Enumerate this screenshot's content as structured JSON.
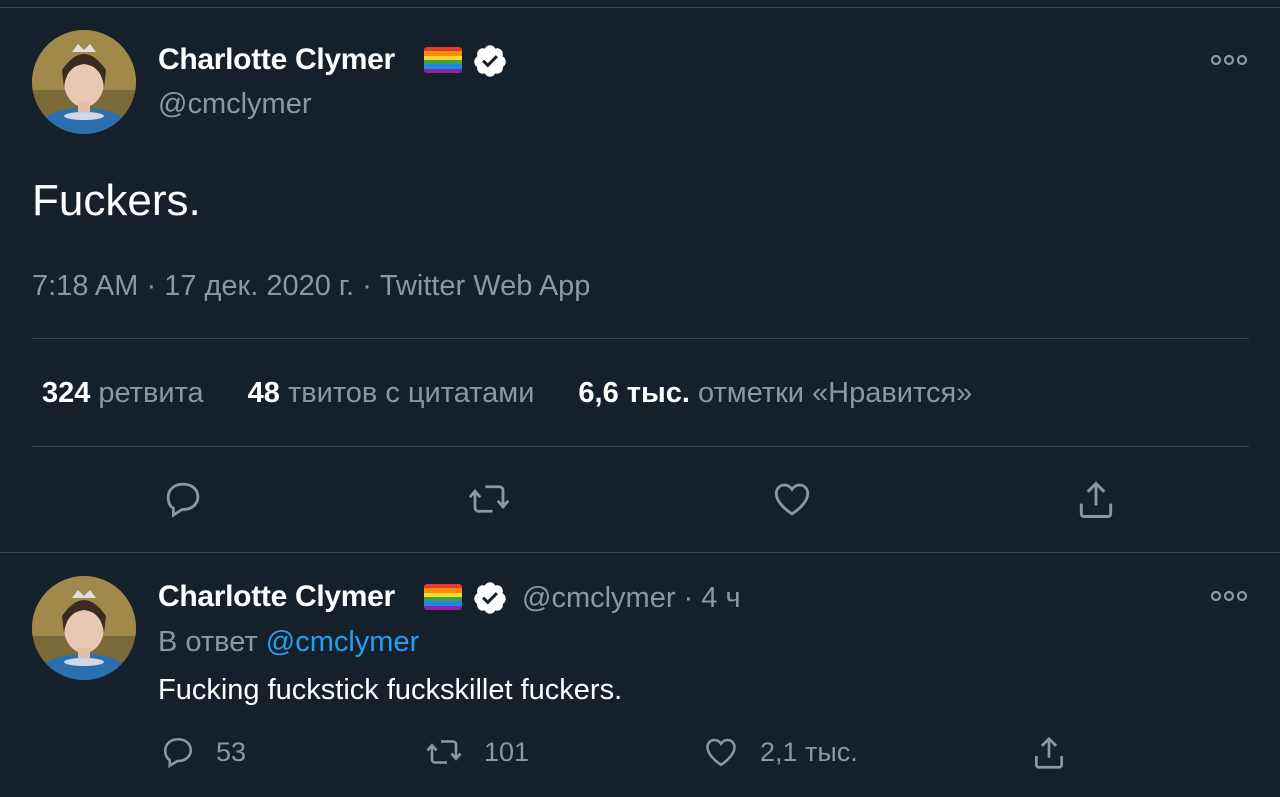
{
  "tweet": {
    "author_name": "Charlotte Clymer",
    "author_handle": "@cmclymer",
    "flag_emoji": "rainbow-flag",
    "verified_icon": "verified-badge-icon",
    "text": "Fuckers.",
    "time": "7:18 AM",
    "date": "17 дек. 2020 г.",
    "source": "Twitter Web App",
    "stats": {
      "retweets_count": "324",
      "retweets_label": "ретвита",
      "quotes_count": "48",
      "quotes_label": "твитов с цитатами",
      "likes_count": "6,6 тыс.",
      "likes_label": "отметки «Нравится»"
    }
  },
  "reply": {
    "author_name": "Charlotte Clymer",
    "author_handle": "@cmclymer",
    "time_ago": "4 ч",
    "reply_prefix": "В ответ",
    "reply_to_handle": "@cmclymer",
    "text": "Fucking fuckstick fuckskillet fuckers.",
    "replies_count": "53",
    "retweets_count": "101",
    "likes_count": "2,1 тыс."
  },
  "colors": {
    "background": "#15202b",
    "divider": "#38444d",
    "muted_text": "#8899a6",
    "link": "#1da1f2",
    "primary_text": "#ffffff"
  }
}
